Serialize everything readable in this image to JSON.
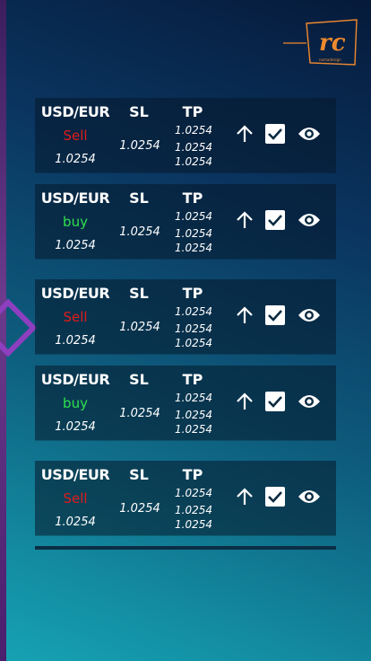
{
  "logo": {
    "text": "rc",
    "tagline": "nomadesign"
  },
  "trades": [
    {
      "pair": "USD/EUR",
      "sl_label": "SL",
      "tp_label": "TP",
      "action": "Sell",
      "action_type": "sell",
      "entry": "1.0254",
      "sl": "1.0254",
      "tp": [
        "1.0254",
        "1.0254",
        "1.0254"
      ]
    },
    {
      "pair": "USD/EUR",
      "sl_label": "SL",
      "tp_label": "TP",
      "action": "buy",
      "action_type": "buy",
      "entry": "1.0254",
      "sl": "1.0254",
      "tp": [
        "1.0254",
        "1.0254",
        "1.0254"
      ]
    },
    {
      "pair": "USD/EUR",
      "sl_label": "SL",
      "tp_label": "TP",
      "action": "Sell",
      "action_type": "sell",
      "entry": "1.0254",
      "sl": "1.0254",
      "tp": [
        "1.0254",
        "1.0254",
        "1.0254"
      ]
    },
    {
      "pair": "USD/EUR",
      "sl_label": "SL",
      "tp_label": "TP",
      "action": "buy",
      "action_type": "buy",
      "entry": "1.0254",
      "sl": "1.0254",
      "tp": [
        "1.0254",
        "1.0254",
        "1.0254"
      ]
    },
    {
      "pair": "USD/EUR",
      "sl_label": "SL",
      "tp_label": "TP",
      "action": "Sell",
      "action_type": "sell",
      "entry": "1.0254",
      "sl": "1.0254",
      "tp": [
        "1.0254",
        "1.0254",
        "1.0254"
      ]
    }
  ],
  "icons": {
    "up": "arrow-up-icon",
    "check": "checkbox-checked-icon",
    "view": "eye-icon"
  },
  "colors": {
    "sell": "#e21b1b",
    "buy": "#2ee04e",
    "accent": "#f08a2e"
  }
}
